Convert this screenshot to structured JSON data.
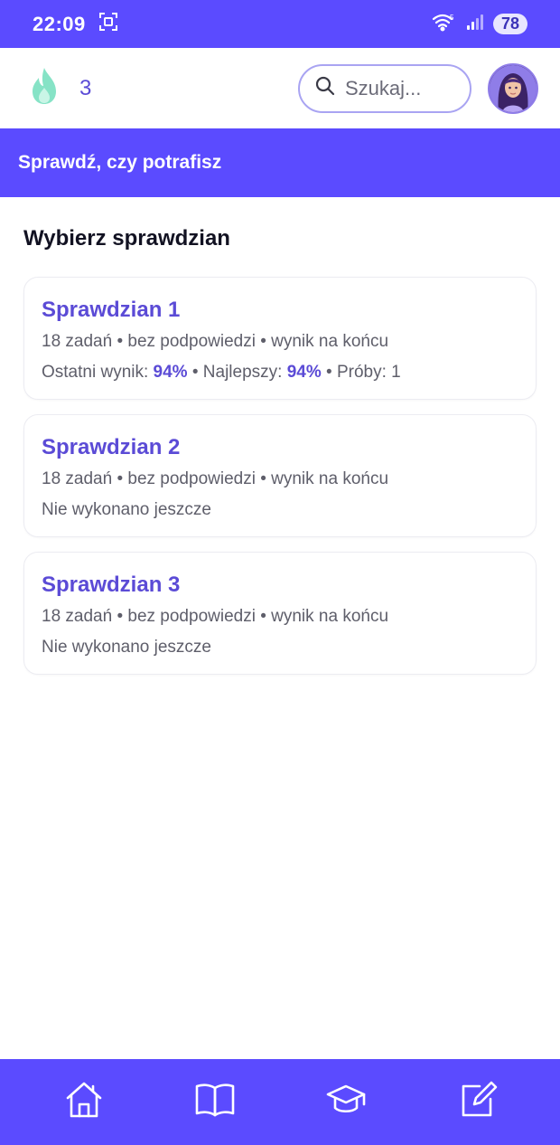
{
  "status_bar": {
    "time": "22:09",
    "battery": "78"
  },
  "top_bar": {
    "streak_count": "3",
    "search_placeholder": "Szukaj..."
  },
  "section_header": {
    "title": "Sprawdź, czy potrafisz"
  },
  "page_title": "Wybierz sprawdzian",
  "tests": [
    {
      "title": "Sprawdzian 1",
      "meta": "18 zadań • bez podpowiedzi • wynik na końcu",
      "last_label": "Ostatni wynik: ",
      "last_value": "94%",
      "best_label": " • Najlepszy: ",
      "best_value": "94%",
      "attempts": " • Próby: 1"
    },
    {
      "title": "Sprawdzian 2",
      "meta": "18 zadań • bez podpowiedzi • wynik na końcu",
      "status": "Nie wykonano jeszcze"
    },
    {
      "title": "Sprawdzian 3",
      "meta": "18 zadań • bez podpowiedzi • wynik na końcu",
      "status": "Nie wykonano jeszcze"
    }
  ],
  "bottom_nav": {
    "items": [
      "home-icon",
      "book-icon",
      "graduation-cap-icon",
      "edit-icon"
    ]
  },
  "colors": {
    "primary": "#5b4bff",
    "accent_text": "#5b4bd6",
    "flame": "#7ee0c0"
  }
}
